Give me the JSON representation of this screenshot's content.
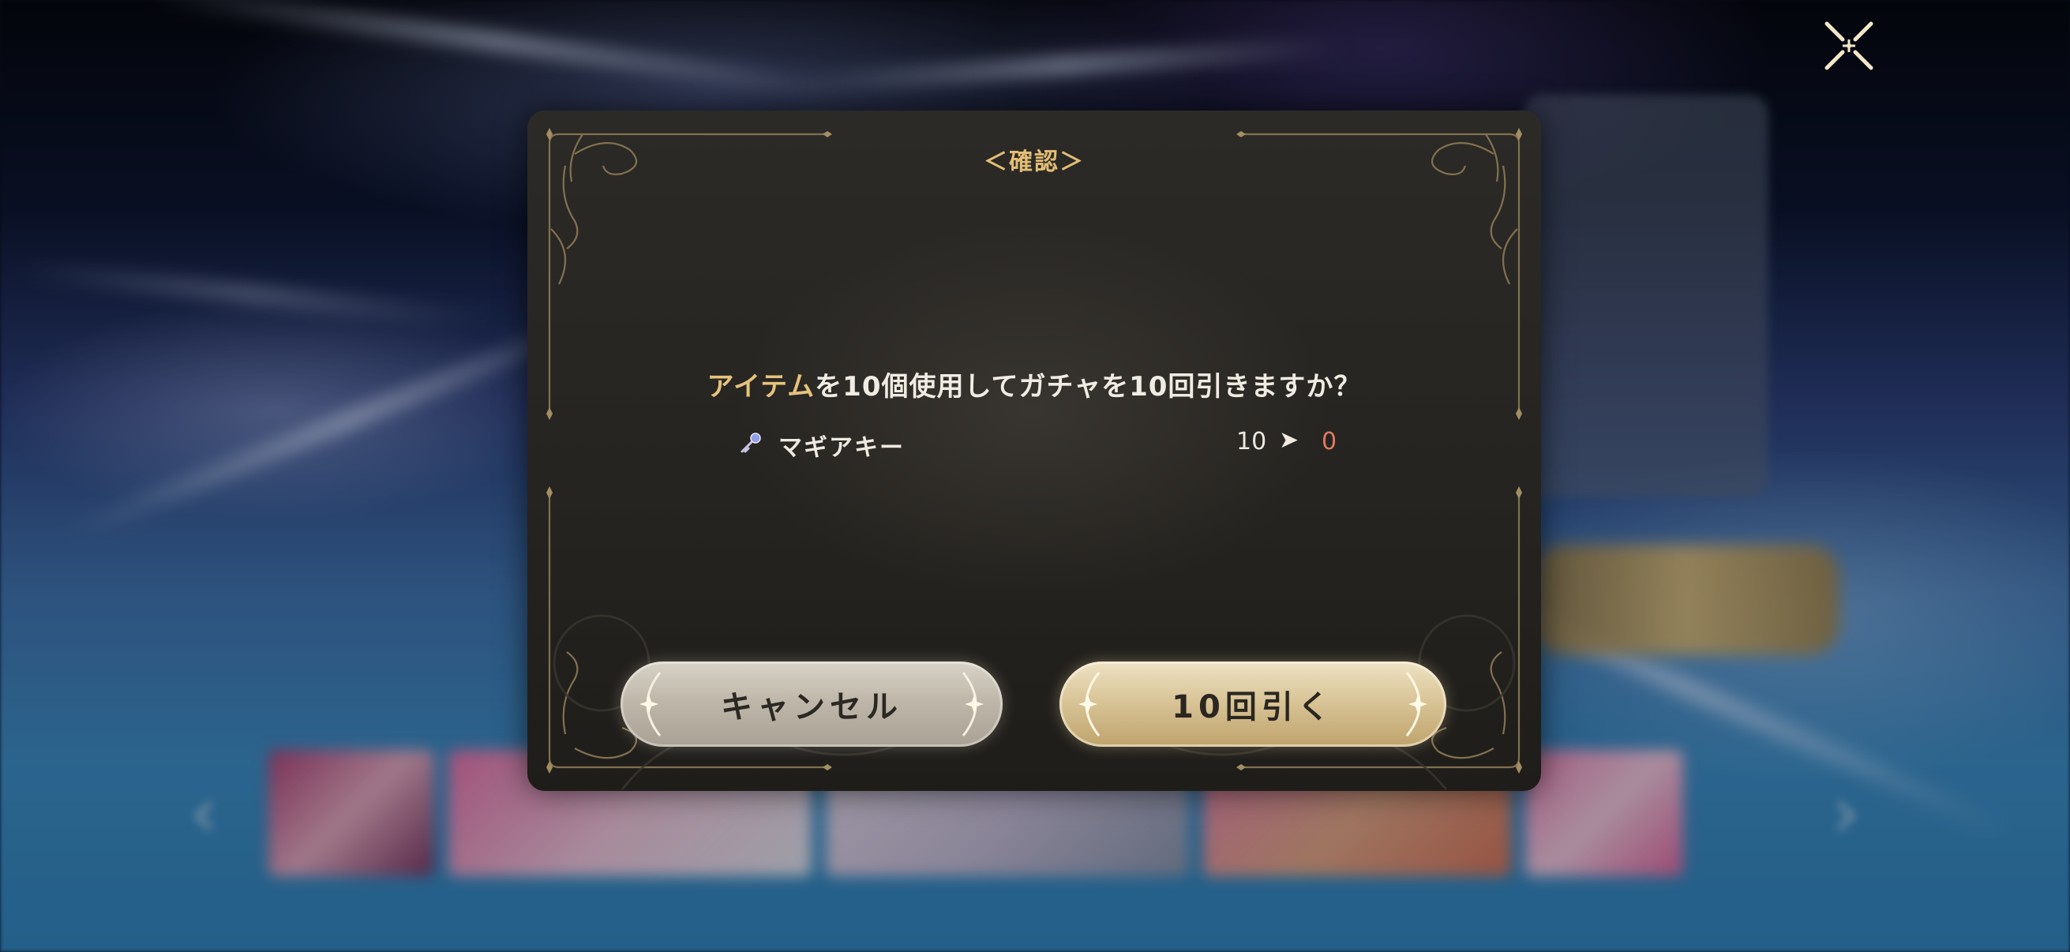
{
  "dialog": {
    "title": "＜確認＞",
    "question_accent": "アイテム",
    "question_rest": "を10個使用してガチャを10回引きますか？",
    "item": {
      "icon": "magi-key-icon",
      "name": "マギアキー",
      "before": "10",
      "arrow": "➤",
      "after": "0"
    },
    "buttons": {
      "cancel_label": "キャンセル",
      "confirm_label": "10回引く"
    }
  },
  "colors": {
    "accent_gold": "#e6c27c",
    "after_value": "#e07a62",
    "dialog_bg": "#262420"
  }
}
